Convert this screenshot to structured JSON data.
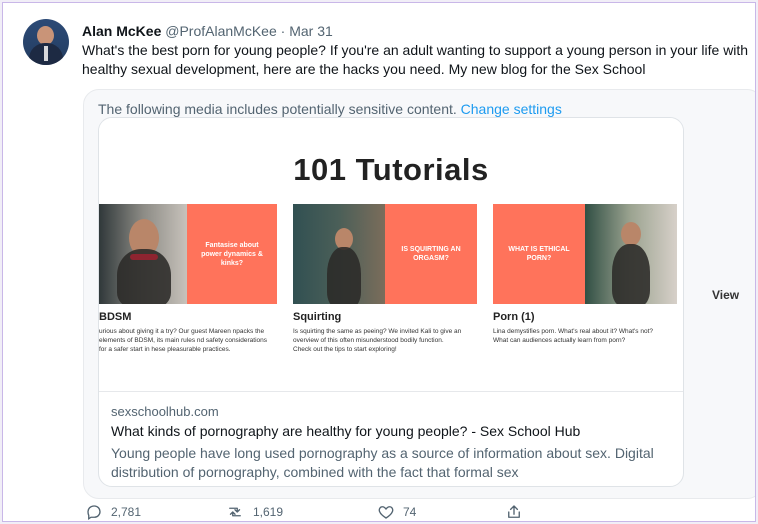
{
  "author": {
    "name": "Alan McKee",
    "handle": "@ProfAlanMcKee",
    "separator": "·",
    "date": "Mar 31"
  },
  "tweet": {
    "text": "What's the best porn for young people? If you're an adult wanting to support a young person in your life with healthy sexual development, here are the hacks you need. My new blog for the Sex School"
  },
  "sensitive": {
    "text": "The following media includes potentially sensitive content.",
    "link": "Change settings"
  },
  "media": {
    "title": "101 Tutorials",
    "view": "View",
    "items": [
      {
        "label": "BDSM",
        "overlay": "Fantasise about power dynamics & kinks?",
        "description": "urious about giving it a try? Our guest Mareen npacks the elements of BDSM, its main rules nd safety considerations for a safer start in hese pleasurable practices."
      },
      {
        "label": "Squirting",
        "overlay": "IS SQUIRTING AN ORGASM?",
        "description": "Is squirting the same as peeing? We invited Kali to give an overview of this often misunderstood bodily function. Check out the tips to start exploring!"
      },
      {
        "label": "Porn (1)",
        "overlay": "WHAT IS ETHICAL PORN?",
        "description": "Lina demystifies porn. What's real about it? What's not? What can audiences actually learn from porn?"
      }
    ]
  },
  "link_card": {
    "domain": "sexschoolhub.com",
    "title": "What kinds of pornography are healthy for young people? - Sex School Hub",
    "description": "Young people have long used pornography as a source of information about sex. Digital distribution of pornography, combined with the fact that formal sex"
  },
  "actions": {
    "reply_icon": "reply-icon",
    "reply_count": "2,781",
    "retweet_icon": "retweet-icon",
    "retweet_count": "1,619",
    "like_icon": "heart-icon",
    "like_count": "74",
    "share_icon": "share-icon"
  },
  "colors": {
    "accent": "#1d9bf0",
    "coral": "#ff735b",
    "text": "#0f1419",
    "muted": "#536471"
  }
}
